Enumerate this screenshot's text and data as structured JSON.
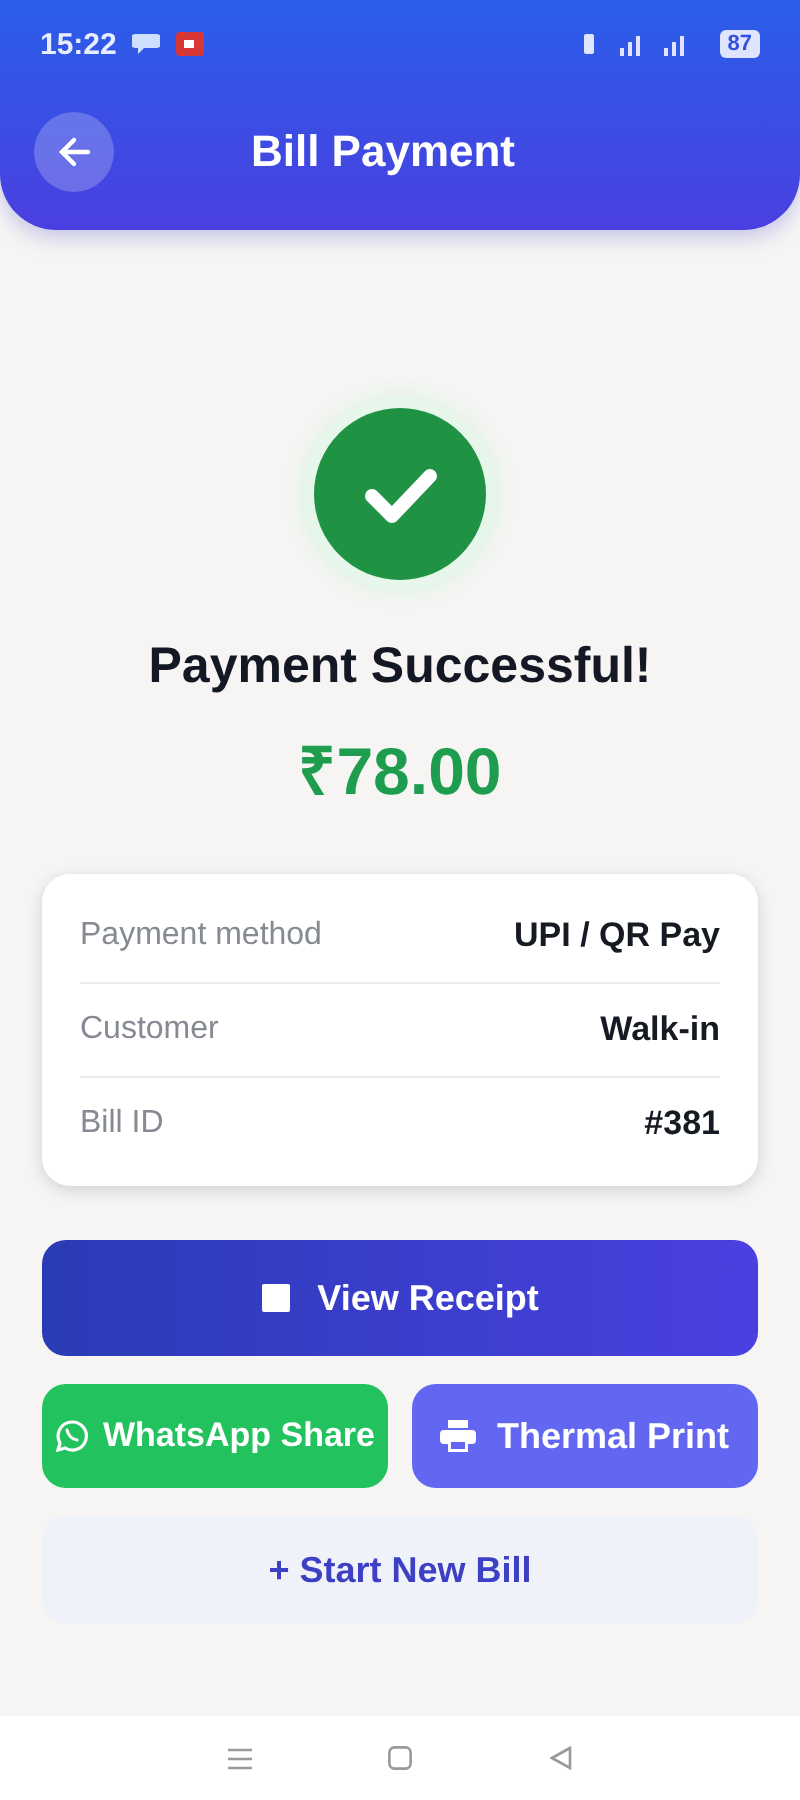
{
  "status_bar": {
    "time": "15:22",
    "battery": "87"
  },
  "header": {
    "title": "Bill Payment"
  },
  "result": {
    "title": "Payment Successful!",
    "amount": "₹78.00"
  },
  "details": [
    {
      "label": "Payment method",
      "value": "UPI / QR Pay"
    },
    {
      "label": "Customer",
      "value": "Walk-in"
    },
    {
      "label": "Bill ID",
      "value": "#381"
    }
  ],
  "actions": [
    {
      "kind": "primary",
      "label": "View Receipt"
    },
    {
      "kind": "whatsapp",
      "label": "WhatsApp Share"
    },
    {
      "kind": "print",
      "label": "Thermal Print"
    },
    {
      "kind": "secondary",
      "label": "+ Start New Bill"
    }
  ]
}
